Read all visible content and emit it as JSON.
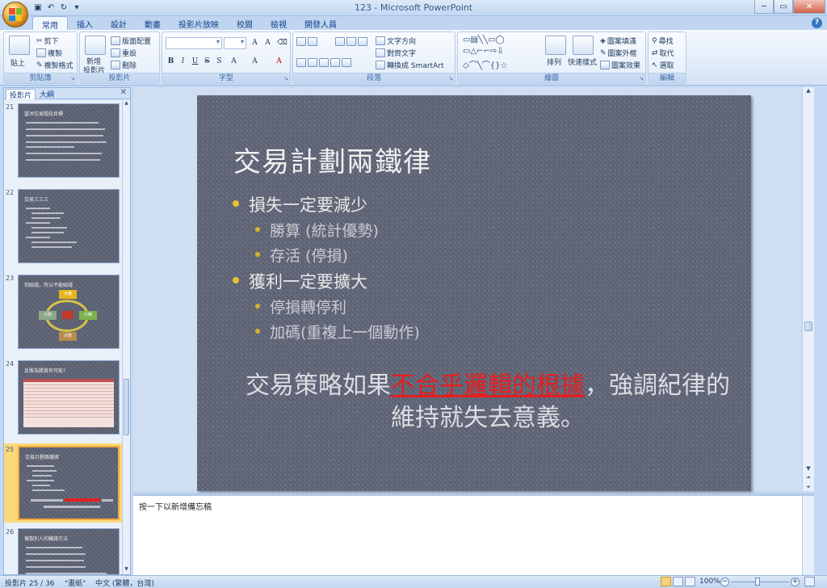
{
  "window": {
    "title": "123 - Microsoft PowerPoint"
  },
  "ribbon_tabs": [
    "常用",
    "插入",
    "設計",
    "動畫",
    "投影片放映",
    "校閱",
    "檢視",
    "開發人員"
  ],
  "ribbon": {
    "clipboard": {
      "paste": "貼上",
      "cut": "剪下",
      "copy": "複製",
      "format_painter": "複製格式",
      "label": "剪貼簿"
    },
    "slides": {
      "new_slide_line1": "新增",
      "new_slide_line2": "投影片",
      "layout": "版面配置",
      "reset": "重設",
      "delete": "刪除",
      "label": "投影片"
    },
    "font": {
      "label": "字型"
    },
    "paragraph": {
      "text_direction": "文字方向",
      "align_text": "對齊文字",
      "convert_smartart": "轉換成 SmartArt",
      "label": "段落"
    },
    "drawing": {
      "arrange": "排列",
      "quick_styles": "快速樣式",
      "shape_fill": "圖案填滿",
      "shape_outline": "圖案外框",
      "shape_effects": "圖案效果",
      "label": "繪圖"
    },
    "editing": {
      "find": "尋找",
      "replace": "取代",
      "select": "選取",
      "label": "編輯"
    }
  },
  "left_pane": {
    "tab_slides": "投影片",
    "tab_outline": "大綱",
    "thumbnails": [
      {
        "num": "21",
        "title": "當沖交易階段目標"
      },
      {
        "num": "22",
        "title": "交易三三三"
      },
      {
        "num": "23",
        "title": "怕賠錢，所以不能賠錢",
        "boxes": [
          "大賺",
          "小賠",
          "小賺",
          "大賠"
        ]
      },
      {
        "num": "24",
        "title": "反敗為勝真有可能?"
      },
      {
        "num": "25",
        "title": "交易計劃兩鐵律"
      },
      {
        "num": "26",
        "title": "複製別人的賺錢方法"
      }
    ]
  },
  "slide": {
    "title": "交易計劃兩鐵律",
    "bullets": [
      {
        "level": 1,
        "text": "損失一定要減少"
      },
      {
        "level": 2,
        "text": "勝算 (統計優勢)"
      },
      {
        "level": 2,
        "text": "存活 (停損)"
      },
      {
        "level": 1,
        "text": "獲利一定要擴大"
      },
      {
        "level": 2,
        "text": "停損轉停利"
      },
      {
        "level": 2,
        "text": "加碼(重複上一個動作)"
      }
    ],
    "quote_before": "交易策略如果",
    "quote_highlight": "不合乎邏輯的根據",
    "quote_after": "，強調紀律的維持就失去意義。",
    "highlight_color": "#e61e1e"
  },
  "notes": {
    "placeholder": "按一下以新增備忘稿"
  },
  "status": {
    "slide_info": "投影片 25 / 36",
    "theme": "\"畫紙\"",
    "language": "中文 (繁體，台灣)",
    "zoom": "100%"
  }
}
